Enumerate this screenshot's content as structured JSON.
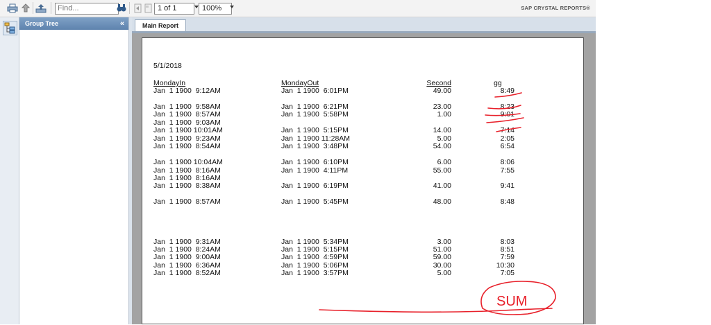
{
  "toolbar": {
    "find_placeholder": "Find...",
    "page_value": "1 of 1",
    "zoom_value": "100%",
    "brand": "SAP CRYSTAL REPORTS®"
  },
  "group_tree": {
    "title": "Group Tree",
    "collapse": "«"
  },
  "tabs": {
    "main": "Main Report"
  },
  "report": {
    "date": "5/1/2018",
    "headers": {
      "in": "MondayIn",
      "out": "MondayOut",
      "second": "Second",
      "gg": "gg"
    },
    "rows": [
      {
        "in": "Jan  1 1900  9:12AM",
        "out": "Jan  1 1900  6:01PM",
        "second": "49.00",
        "gg": "8:49"
      },
      {
        "in": "",
        "out": "",
        "second": "",
        "gg": ""
      },
      {
        "in": "Jan  1 1900  9:58AM",
        "out": "Jan  1 1900  6:21PM",
        "second": "23.00",
        "gg": "8:23"
      },
      {
        "in": "Jan  1 1900  8:57AM",
        "out": "Jan  1 1900  5:58PM",
        "second": "1.00",
        "gg": "9:01"
      },
      {
        "in": "Jan  1 1900  9:03AM",
        "out": "",
        "second": "",
        "gg": ""
      },
      {
        "in": "Jan  1 1900 10:01AM",
        "out": "Jan  1 1900  5:15PM",
        "second": "14.00",
        "gg": "7:14"
      },
      {
        "in": "Jan  1 1900  9:23AM",
        "out": "Jan  1 1900 11:28AM",
        "second": "5.00",
        "gg": "2:05"
      },
      {
        "in": "Jan  1 1900  8:54AM",
        "out": "Jan  1 1900  3:48PM",
        "second": "54.00",
        "gg": "6:54"
      },
      {
        "in": "",
        "out": "",
        "second": "",
        "gg": ""
      },
      {
        "in": "Jan  1 1900 10:04AM",
        "out": "Jan  1 1900  6:10PM",
        "second": "6.00",
        "gg": "8:06"
      },
      {
        "in": "Jan  1 1900  8:16AM",
        "out": "Jan  1 1900  4:11PM",
        "second": "55.00",
        "gg": "7:55"
      },
      {
        "in": "Jan  1 1900  8:16AM",
        "out": "",
        "second": "",
        "gg": ""
      },
      {
        "in": "Jan  1 1900  8:38AM",
        "out": "Jan  1 1900  6:19PM",
        "second": "41.00",
        "gg": "9:41"
      },
      {
        "in": "",
        "out": "",
        "second": "",
        "gg": ""
      },
      {
        "in": "Jan  1 1900  8:57AM",
        "out": "Jan  1 1900  5:45PM",
        "second": "48.00",
        "gg": "8:48"
      },
      {
        "in": "",
        "out": "",
        "second": "",
        "gg": ""
      },
      {
        "in": "",
        "out": "",
        "second": "",
        "gg": ""
      },
      {
        "in": "",
        "out": "",
        "second": "",
        "gg": ""
      },
      {
        "in": "",
        "out": "",
        "second": "",
        "gg": ""
      },
      {
        "in": "Jan  1 1900  9:31AM",
        "out": "Jan  1 1900  5:34PM",
        "second": "3.00",
        "gg": "8:03"
      },
      {
        "in": "Jan  1 1900  8:24AM",
        "out": "Jan  1 1900  5:15PM",
        "second": "51.00",
        "gg": "8:51"
      },
      {
        "in": "Jan  1 1900  9:00AM",
        "out": "Jan  1 1900  4:59PM",
        "second": "59.00",
        "gg": "7:59"
      },
      {
        "in": "Jan  1 1900  6:36AM",
        "out": "Jan  1 1900  5:06PM",
        "second": "30.00",
        "gg": "10:30"
      },
      {
        "in": "Jan  1 1900  8:52AM",
        "out": "Jan  1 1900  3:57PM",
        "second": "5.00",
        "gg": "7:05"
      }
    ],
    "annotation": "SUM"
  },
  "colors": {
    "annotation": "#e8202a",
    "header_blue": "#5e83ae"
  },
  "icons": [
    "print-icon",
    "export-icon",
    "upload-icon",
    "binoculars-icon",
    "first-page-icon",
    "prev-page-icon",
    "group-tree-icon"
  ]
}
